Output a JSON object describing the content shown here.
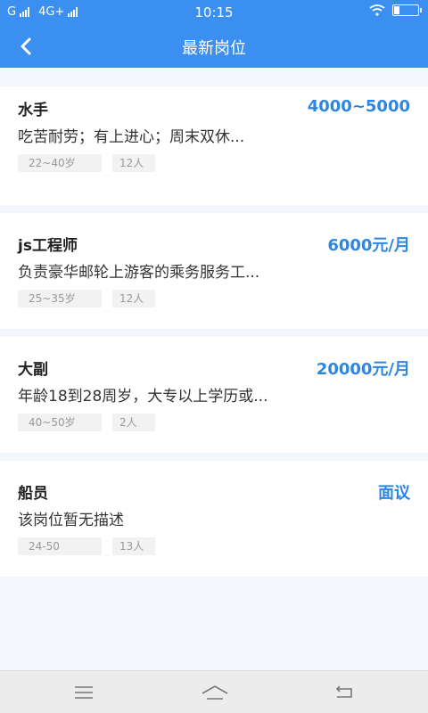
{
  "status_bar": {
    "carrier1": "G",
    "carrier2": "4G+",
    "time": "10:15"
  },
  "header": {
    "title": "最新岗位"
  },
  "jobs": [
    {
      "title": "水手",
      "salary": "4000~5000",
      "desc": "吃苦耐劳；有上进心；周末双休...",
      "age": "22~40岁",
      "count": "12人"
    },
    {
      "title": "js工程师",
      "salary": "6000元/月",
      "desc": "负责豪华邮轮上游客的乘务服务工...",
      "age": "25~35岁",
      "count": "12人"
    },
    {
      "title": "大副",
      "salary": "20000元/月",
      "desc": "年龄18到28周岁，大专以上学历或...",
      "age": "40~50岁",
      "count": "2人"
    },
    {
      "title": "船员",
      "salary": "面议",
      "desc": "该岗位暂无描述",
      "age": "24-50",
      "count": "13人"
    }
  ],
  "theme": {
    "primary": "#3a8ff0",
    "salary_color": "#2f86e0"
  },
  "icons": {
    "back": "chevron-left-icon",
    "menu": "menu-icon",
    "home": "home-icon",
    "return": "return-icon"
  }
}
